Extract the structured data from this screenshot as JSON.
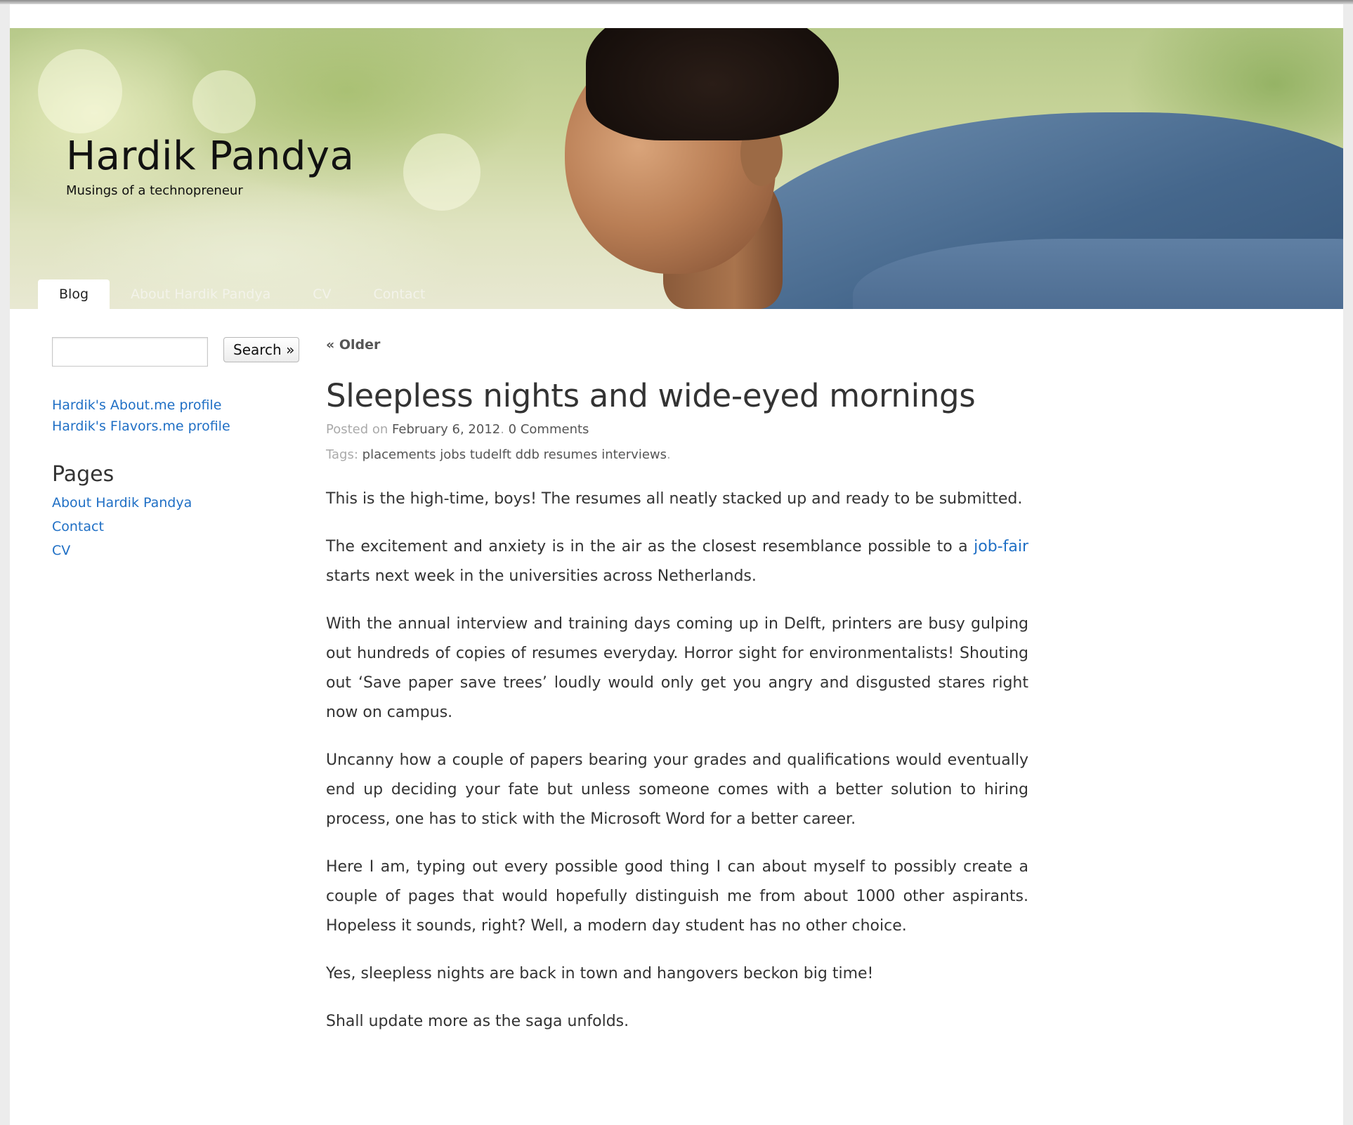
{
  "site": {
    "title": "Hardik Pandya",
    "tagline": "Musings of a technopreneur"
  },
  "nav": {
    "tabs": [
      {
        "label": "Blog",
        "active": true
      },
      {
        "label": "About Hardik Pandya",
        "active": false
      },
      {
        "label": "CV",
        "active": false
      },
      {
        "label": "Contact",
        "active": false
      }
    ]
  },
  "sidebar": {
    "search": {
      "value": "",
      "placeholder": "",
      "button_label": "Search »"
    },
    "profile_links": [
      "Hardik's About.me profile",
      "Hardik's Flavors.me profile"
    ],
    "pages_heading": "Pages",
    "pages": [
      "About Hardik Pandya",
      "Contact",
      "CV"
    ]
  },
  "main": {
    "older_link": "« Older",
    "post": {
      "title": "Sleepless nights and wide-eyed mornings",
      "posted_prefix": "Posted on ",
      "date": "February 6, 2012",
      "comments": "0 Comments",
      "tags_prefix": "Tags: ",
      "tags": [
        "placements",
        "jobs",
        "tudelft",
        "ddb",
        "resumes",
        "interviews"
      ],
      "paragraphs": {
        "p1": "This is the high-time, boys! The resumes all neatly stacked up and ready to be submitted.",
        "p2_before": "The excitement and anxiety is in the air as the closest resemblance possible to a ",
        "p2_link": "job-fair",
        "p2_after": " starts next week in the universities across Netherlands.",
        "p3": "With the annual interview and training days coming up in Delft, printers are busy gulping out hundreds of copies of resumes everyday. Horror sight for environmentalists! Shouting out ‘Save paper save trees’ loudly would only get you angry and disgusted stares right now on campus.",
        "p4": "Uncanny how a couple of papers bearing your grades and qualifications would eventually end up deciding your fate but unless someone comes with a better solution to hiring process, one has to stick with the Microsoft Word for a better career.",
        "p5": "Here I am, typing out every possible good thing I can about myself to possibly create a couple of pages that would hopefully distinguish me from about 1000 other aspirants. Hopeless it sounds, right? Well, a modern day student has no other choice.",
        "p6": "Yes, sleepless nights are back in town and hangovers beckon big time!",
        "p7": "Shall update more as the saga unfolds."
      }
    }
  },
  "colors": {
    "link": "#1f6fc5",
    "text": "#333333",
    "meta_light": "#aaaaaa",
    "meta_dark": "#555555"
  }
}
